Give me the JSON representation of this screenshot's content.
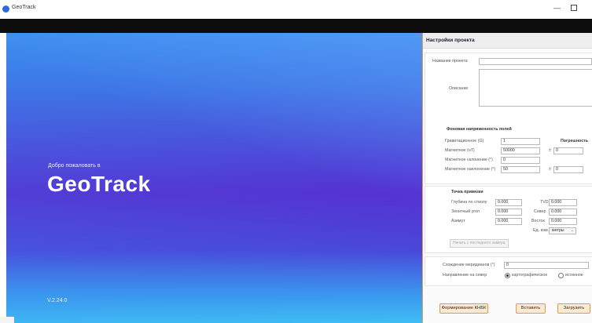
{
  "window": {
    "app_icon": "geotrack-logo-icon",
    "title": "GeoTrack",
    "minimize_glyph": "—"
  },
  "hero": {
    "welcome": "Добро пожаловать в",
    "brand": "GeoTrack",
    "version": "V.2.24.0",
    "gradient_colors": [
      "#3d8ff0",
      "#5532d2",
      "#3fc4f4"
    ]
  },
  "panel": {
    "title": "Настройки проекта",
    "project": {
      "name_label": "Название проекта",
      "name_value": "",
      "description_label": "Описание",
      "description_value": ""
    },
    "fields": {
      "section_title": "Фоновая напряженность полей",
      "error_header": "Погрешность",
      "gravity_label": "Гравитационное (G)",
      "gravity_value": "1",
      "magnetic_label": "Магнитное (нТ)",
      "magnetic_value": "50000",
      "pm": "±",
      "magnetic_error": "0",
      "declination_label": "Магнитное склонение (°)",
      "declination_value": "0",
      "inclination_label": "Магнитное наклонение (°)",
      "inclination_value": "50",
      "inclination_error": "0"
    },
    "tie_point": {
      "title": "Точка привязки",
      "md_label": "Глубина по стволу",
      "md_value": "0.000",
      "zenith_label": "Зенитный угол",
      "zenith_value": "0.000",
      "azimuth_label": "Азимут",
      "azimuth_value": "0.000",
      "tvd_label": "TVD",
      "tvd_value": "0.000",
      "north_label": "Север",
      "north_value": "0.000",
      "east_label": "Восток",
      "east_value": "0.000",
      "units_label": "Ед. изм.",
      "units_value": "метры",
      "start_button": "Начать с последнего замера"
    },
    "meridian": {
      "convergence_label": "Схождение меридианов (°)",
      "convergence_value": "0",
      "north_direction_label": "Направление на север",
      "option_grid": "картографическое",
      "option_true": "истинное"
    },
    "buttons": {
      "form": "Формирование КНБК",
      "insert": "Вставить",
      "load": "Загрузить"
    }
  }
}
